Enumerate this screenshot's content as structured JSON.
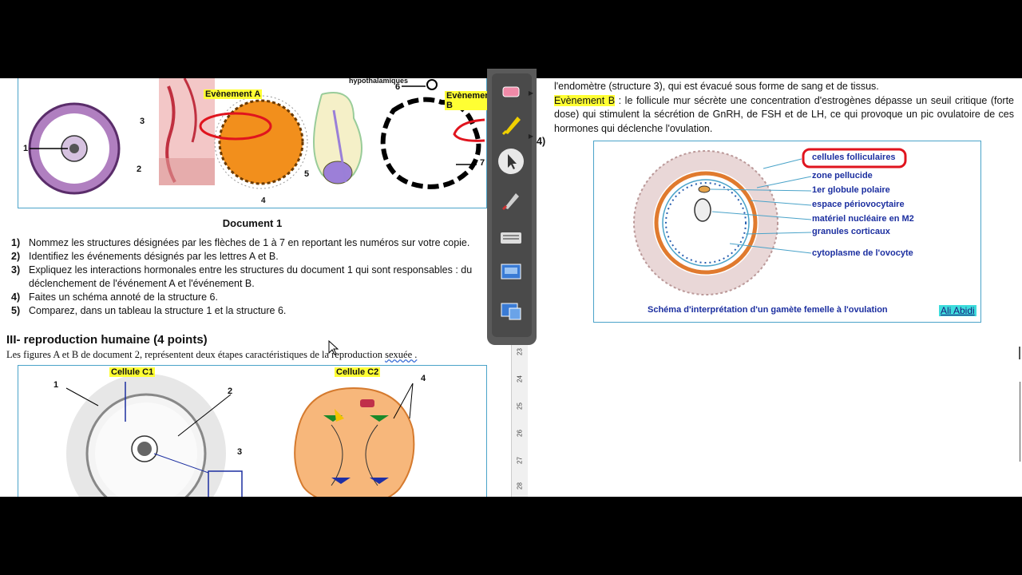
{
  "document1": {
    "title": "Document 1",
    "labels": {
      "n1": "1",
      "n2": "2",
      "n3": "3",
      "n4": "4",
      "n5": "5",
      "n6": "6",
      "n7": "7",
      "event_a": "Evènement A",
      "event_b": "Evènement B",
      "hypothalamic": "hypothalamiques"
    },
    "questions": [
      {
        "num": "1)",
        "text": "Nommez les structures désignées par les flèches de 1 à 7 en reportant les numéros sur votre copie."
      },
      {
        "num": "2)",
        "text": "Identifiez les événements désignés par les lettres A et B."
      },
      {
        "num": "3)",
        "text": "Expliquez les interactions hormonales entre les structures du document 1 qui sont responsables : du déclenchement de l'événement A et l'événement B."
      },
      {
        "num": "4)",
        "text": "Faites un schéma annoté de la structure 6."
      },
      {
        "num": "5)",
        "text": "Comparez, dans un tableau la structure 1 et la structure 6."
      }
    ]
  },
  "section3": {
    "title": "III- reproduction humaine (4 points)",
    "intro": "Les figures A et B de document 2, représentent deux étapes caractéristiques de la reproduction ",
    "intro_end": "sexuée .",
    "cell_c1": "Cellule C1",
    "cell_c2": "Cellule C2",
    "labels": {
      "n1": "1",
      "n2": "2",
      "n3": "3",
      "n4": "4"
    }
  },
  "answers": {
    "line1": "l'endomètre (structure 3), qui est évacué sous forme de sang et de tissus.",
    "event_b_label": "Evènement B",
    "event_b_text": " : le follicule mur sécrète une concentration d'estrogènes dépasse un seuil critique (forte dose) qui stimulent la sécrétion de GnRH, de FSH et de LH, ce qui provoque un pic ovulatoire de ces hormones qui déclenche l'ovulation.",
    "q4": "4)",
    "figure": {
      "labels": [
        "cellules folliculaires",
        "zone pellucide",
        "1er globule polaire",
        "espace périovocytaire",
        "matériel nucléaire en M2",
        "granules corticaux",
        "cytoplasme de l'ovocyte"
      ],
      "caption": "Schéma d'interprétation d'un gamète femelle à l'ovulation",
      "author": "Ali Abidi"
    }
  },
  "ruler_ticks": [
    "23",
    "24",
    "25",
    "26",
    "27",
    "28"
  ],
  "colors": {
    "accent_border": "#4aa3c9",
    "highlight": "#ffff33",
    "annotation_red": "#e0141e",
    "label_blue": "#1c2fa0"
  }
}
